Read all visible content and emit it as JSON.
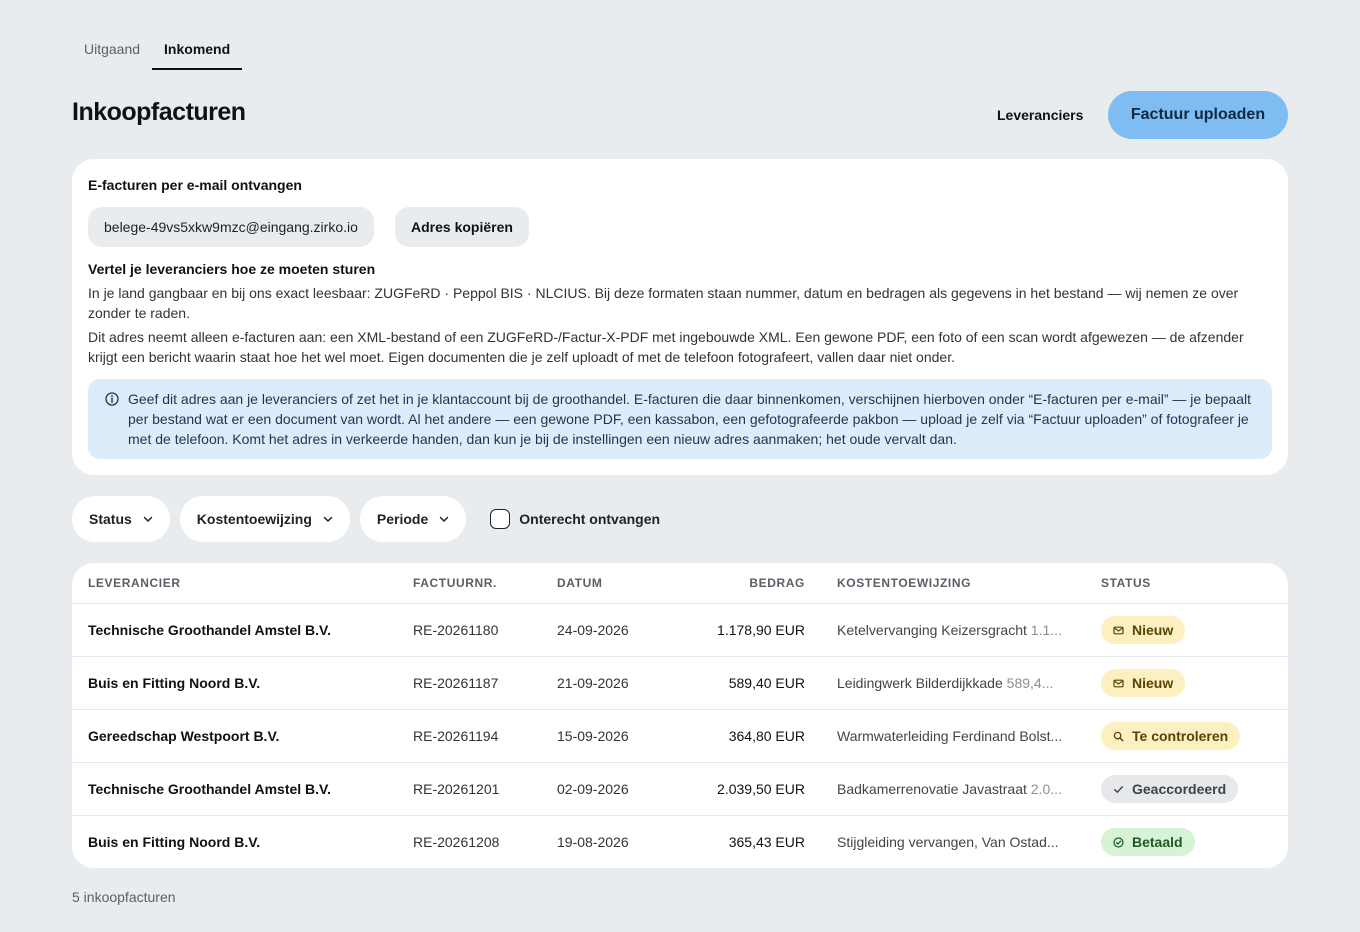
{
  "tabs": [
    {
      "label": "Uitgaand",
      "active": false
    },
    {
      "label": "Inkomend",
      "active": true
    }
  ],
  "header": {
    "title": "Inkoopfacturen",
    "suppliers_link": "Leveranciers",
    "upload_button": "Factuur uploaden"
  },
  "email_card": {
    "title": "E-facturen per e-mail ontvangen",
    "address": "belege-49vs5xkw9mzc@eingang.zirko.io",
    "copy_button": "Adres kopiëren",
    "subtitle": "Vertel je leveranciers hoe ze moeten sturen",
    "paragraph1": "In je land gangbaar en bij ons exact leesbaar: ZUGFeRD · Peppol BIS · NLCIUS. Bij deze formaten staan nummer, datum en bedragen als gegevens in het bestand — wij nemen ze over zonder te raden.",
    "paragraph2": "Dit adres neemt alleen e-facturen aan: een XML-bestand of een ZUGFeRD-/Factur-X-PDF met ingebouwde XML. Een gewone PDF, een foto of een scan wordt afgewezen — de afzender krijgt een bericht waarin staat hoe het wel moet. Eigen documenten die je zelf uploadt of met de telefoon fotografeert, vallen daar niet onder.",
    "notice": "Geef dit adres aan je leveranciers of zet het in je klantaccount bij de groothandel. E-facturen die daar binnenkomen, verschijnen hierboven onder “E-facturen per e-mail” — je bepaalt per bestand wat er een document van wordt. Al het andere — een gewone PDF, een kassabon, een gefotografeerde pakbon — upload je zelf via “Factuur uploaden” of fotografeer je met de telefoon. Komt het adres in verkeerde handen, dan kun je bij de instellingen een nieuw adres aanmaken; het oude vervalt dan."
  },
  "filters": {
    "status": "Status",
    "cost": "Kostentoewijzing",
    "period": "Periode",
    "wrongly_received": "Onterecht ontvangen"
  },
  "table": {
    "headers": {
      "supplier": "LEVERANCIER",
      "number": "FACTUURNR.",
      "date": "DATUM",
      "amount": "BEDRAG",
      "cost": "KOSTENTOEWIJZING",
      "status": "STATUS"
    },
    "rows": [
      {
        "supplier": "Technische Groothandel Amstel B.V.",
        "number": "RE-20261180",
        "date": "24-09-2026",
        "amount": "1.178,90 EUR",
        "cost": "Ketelvervanging Keizersgracht",
        "cost_amount": "1.1...",
        "status": "Nieuw"
      },
      {
        "supplier": "Buis en Fitting Noord B.V.",
        "number": "RE-20261187",
        "date": "21-09-2026",
        "amount": "589,40 EUR",
        "cost": "Leidingwerk Bilderdijkkade",
        "cost_amount": "589,4...",
        "status": "Nieuw"
      },
      {
        "supplier": "Gereedschap Westpoort B.V.",
        "number": "RE-20261194",
        "date": "15-09-2026",
        "amount": "364,80 EUR",
        "cost": "Warmwaterleiding Ferdinand Bolst...",
        "cost_amount": "",
        "status": "Te controleren"
      },
      {
        "supplier": "Technische Groothandel Amstel B.V.",
        "number": "RE-20261201",
        "date": "02-09-2026",
        "amount": "2.039,50 EUR",
        "cost": "Badkamerrenovatie Javastraat",
        "cost_amount": "2.0...",
        "status": "Geaccordeerd"
      },
      {
        "supplier": "Buis en Fitting Noord B.V.",
        "number": "RE-20261208",
        "date": "19-08-2026",
        "amount": "365,43 EUR",
        "cost": "Stijgleiding vervangen, Van Ostad...",
        "cost_amount": "",
        "status": "Betaald"
      }
    ]
  },
  "footer": {
    "count": "5 inkoopfacturen"
  },
  "colors": {
    "primary": "#7fbcf2",
    "background": "#e9ecef",
    "notice": "#dcecfb"
  }
}
